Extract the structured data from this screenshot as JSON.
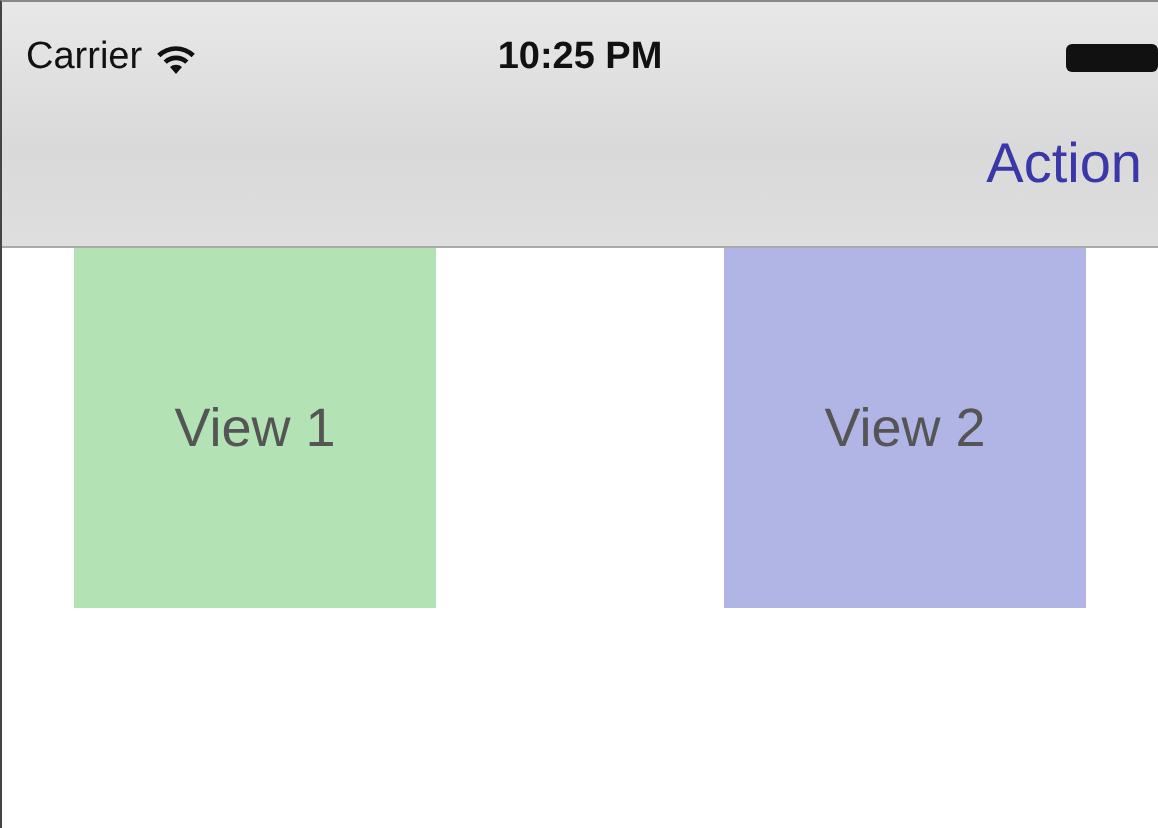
{
  "status_bar": {
    "carrier": "Carrier",
    "time": "10:25 PM"
  },
  "nav_bar": {
    "action": "Action"
  },
  "views": [
    {
      "label": "View 1",
      "color": "#b3e3b5"
    },
    {
      "label": "View 2",
      "color": "#b1b5e5"
    }
  ]
}
